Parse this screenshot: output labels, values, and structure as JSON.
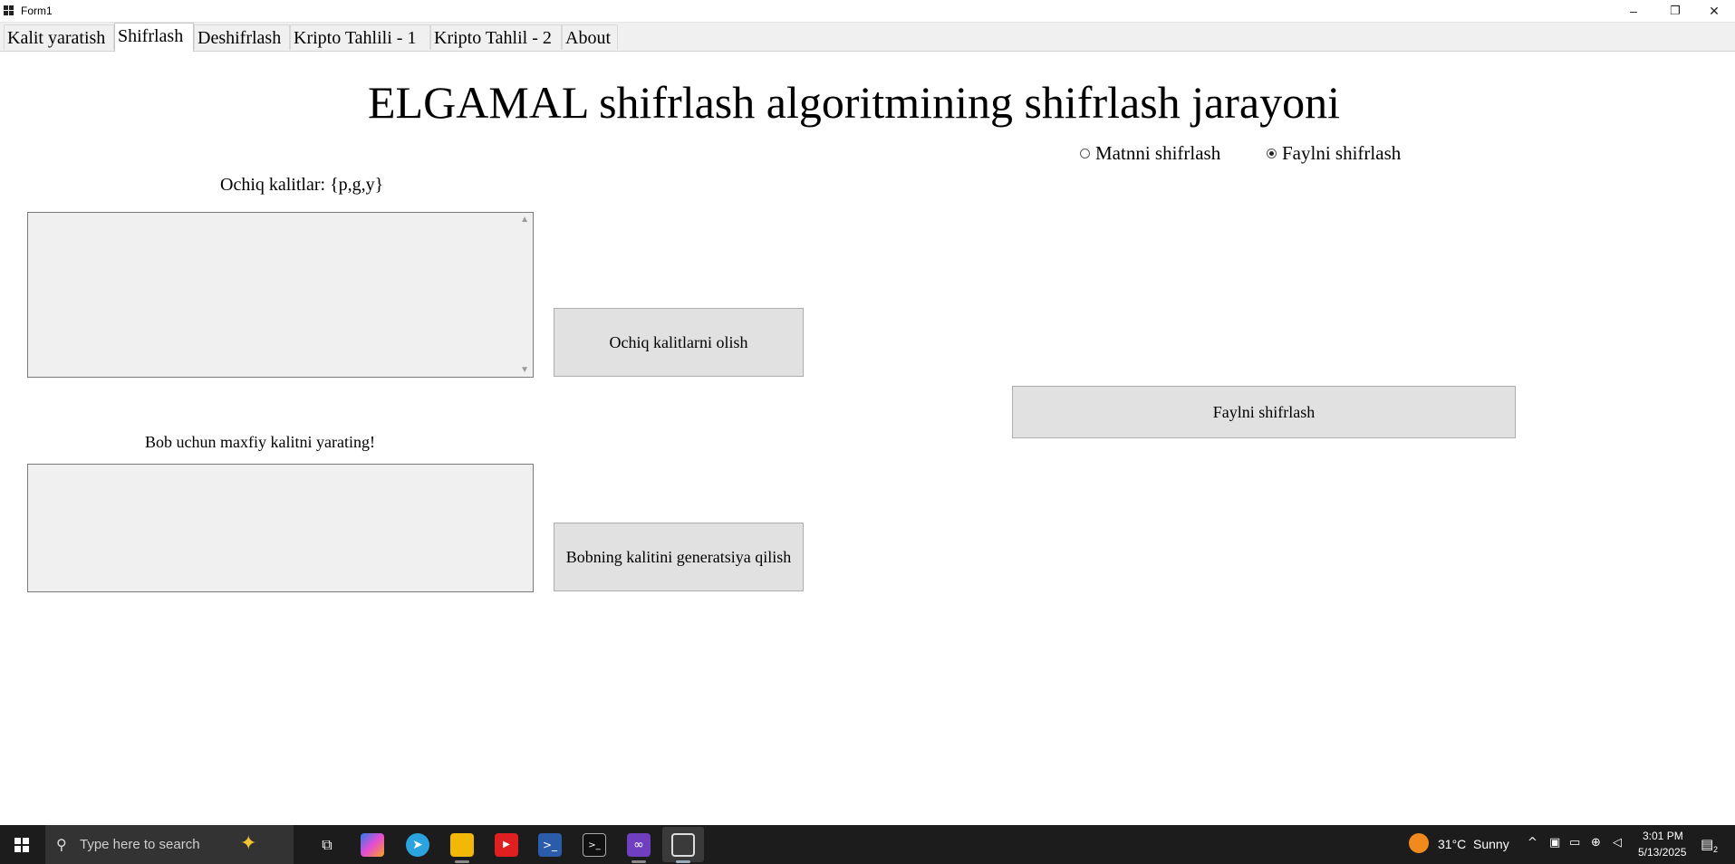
{
  "window": {
    "title": "Form1",
    "minimize": "–",
    "restore": "❐",
    "close": "✕"
  },
  "tabs": [
    {
      "label": "Kalit yaratish"
    },
    {
      "label": "Shifrlash"
    },
    {
      "label": "Deshifrlash"
    },
    {
      "label": "Kripto Tahlili - 1"
    },
    {
      "label": "Kripto Tahlil - 2"
    },
    {
      "label": "About"
    }
  ],
  "active_tab": "Shifrlash",
  "main": {
    "heading": "ELGAMAL shifrlash algoritmining shifrlash jarayoni",
    "mode_options": [
      {
        "label": "Matnni shifrlash",
        "selected": false
      },
      {
        "label": "Faylni shifrlash",
        "selected": true
      }
    ],
    "public_keys_label": "Ochiq kalitlar: {p,g,y}",
    "public_keys_value": "",
    "get_public_keys_button": "Ochiq kalitlarni olish",
    "bob_secret_label": "Bob uchun maxfiy kalitni yarating!",
    "bob_secret_value": "",
    "generate_bob_key_button": "Bobning kalitini generatsiya qilish",
    "encrypt_file_button": "Faylni shifrlash"
  },
  "taskbar": {
    "search_placeholder": "Type here to search",
    "weather_temp": "31°C",
    "weather_text": "Sunny",
    "time": "3:01 PM",
    "date": "5/13/2025",
    "notification_count": "2"
  }
}
